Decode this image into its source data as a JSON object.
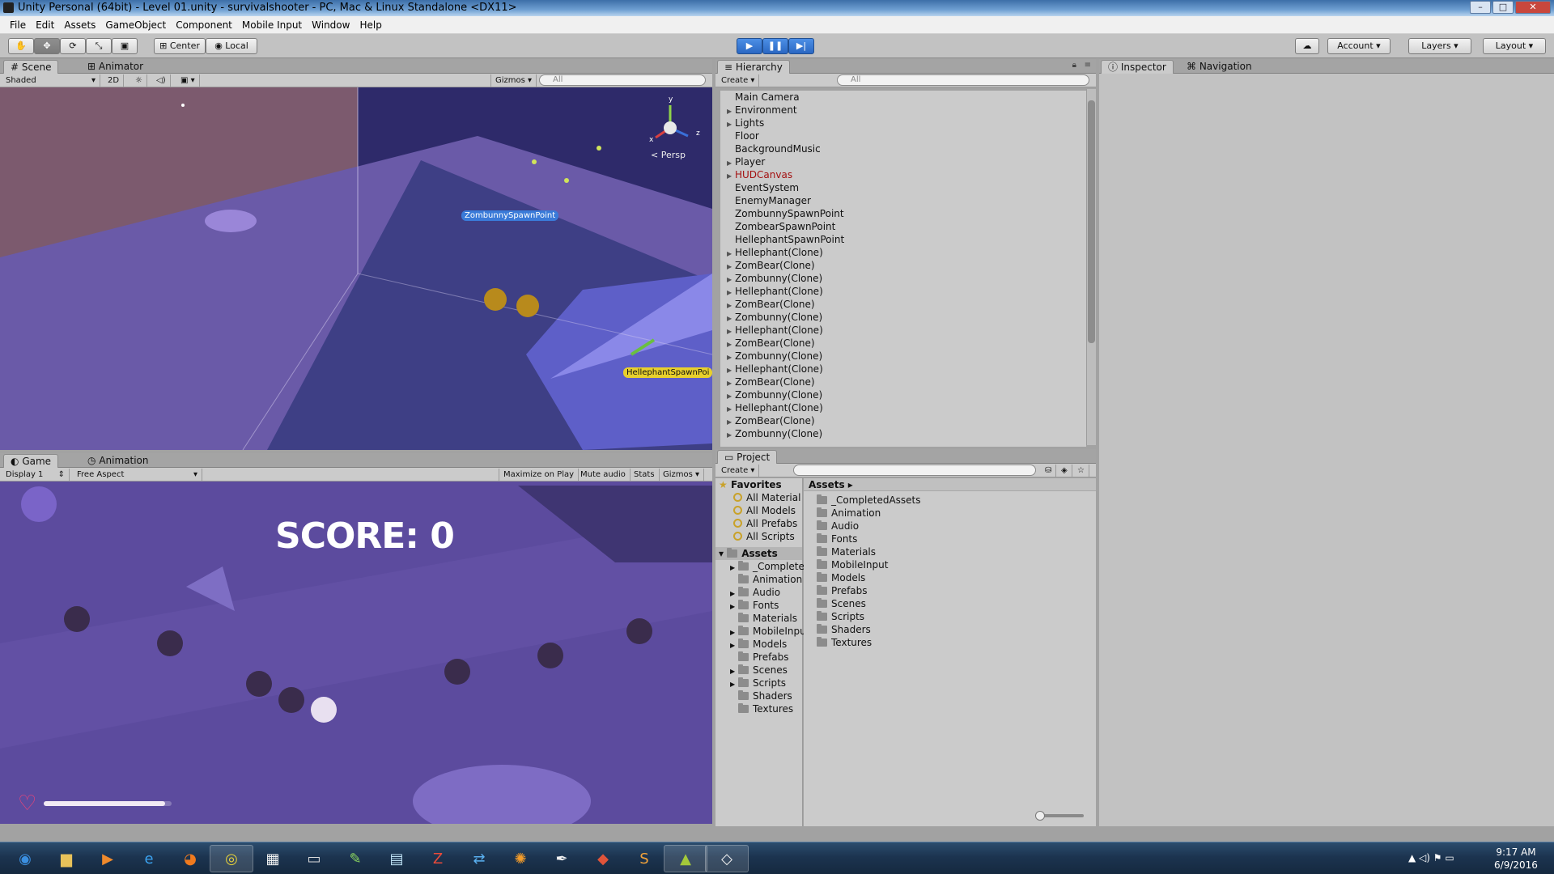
{
  "window": {
    "title": "Unity Personal (64bit) - Level 01.unity - survivalshooter - PC, Mac & Linux Standalone <DX11>"
  },
  "menu": [
    "File",
    "Edit",
    "Assets",
    "GameObject",
    "Component",
    "Mobile Input",
    "Window",
    "Help"
  ],
  "toolbar": {
    "pivot_label": "Center",
    "space_label": "Local",
    "account_label": "Account",
    "layers_label": "Layers",
    "layout_label": "Layout"
  },
  "scene_panel": {
    "tabs": [
      "Scene",
      "Animator"
    ],
    "shading": "Shaded",
    "mode_2d": "2D",
    "gizmos": "Gizmos",
    "search_placeholder": "All",
    "persp_label": "Persp",
    "label_zombunny": "ZombunnySpawnPoint",
    "label_hellephant": "HellephantSpawnPoi",
    "axis_y": "y",
    "axis_x": "x",
    "axis_z": "z"
  },
  "game_panel": {
    "tabs": [
      "Game",
      "Animation"
    ],
    "display": "Display 1",
    "aspect": "Free Aspect",
    "maximize": "Maximize on Play",
    "mute": "Mute audio",
    "stats": "Stats",
    "gizmos": "Gizmos",
    "score_text": "SCORE: 0",
    "health_fraction": 0.95
  },
  "hierarchy": {
    "tab": "Hierarchy",
    "create": "Create",
    "search_placeholder": "All",
    "items": [
      {
        "label": "Main Camera",
        "arrow": false,
        "red": false
      },
      {
        "label": "Environment",
        "arrow": true,
        "red": false
      },
      {
        "label": "Lights",
        "arrow": true,
        "red": false
      },
      {
        "label": "Floor",
        "arrow": false,
        "red": false
      },
      {
        "label": "BackgroundMusic",
        "arrow": false,
        "red": false
      },
      {
        "label": "Player",
        "arrow": true,
        "red": false
      },
      {
        "label": "HUDCanvas",
        "arrow": true,
        "red": true
      },
      {
        "label": "EventSystem",
        "arrow": false,
        "red": false
      },
      {
        "label": "EnemyManager",
        "arrow": false,
        "red": false
      },
      {
        "label": "ZombunnySpawnPoint",
        "arrow": false,
        "red": false
      },
      {
        "label": "ZombearSpawnPoint",
        "arrow": false,
        "red": false
      },
      {
        "label": "HellephantSpawnPoint",
        "arrow": false,
        "red": false
      },
      {
        "label": "Hellephant(Clone)",
        "arrow": true,
        "red": false
      },
      {
        "label": "ZomBear(Clone)",
        "arrow": true,
        "red": false
      },
      {
        "label": "Zombunny(Clone)",
        "arrow": true,
        "red": false
      },
      {
        "label": "Hellephant(Clone)",
        "arrow": true,
        "red": false
      },
      {
        "label": "ZomBear(Clone)",
        "arrow": true,
        "red": false
      },
      {
        "label": "Zombunny(Clone)",
        "arrow": true,
        "red": false
      },
      {
        "label": "Hellephant(Clone)",
        "arrow": true,
        "red": false
      },
      {
        "label": "ZomBear(Clone)",
        "arrow": true,
        "red": false
      },
      {
        "label": "Zombunny(Clone)",
        "arrow": true,
        "red": false
      },
      {
        "label": "Hellephant(Clone)",
        "arrow": true,
        "red": false
      },
      {
        "label": "ZomBear(Clone)",
        "arrow": true,
        "red": false
      },
      {
        "label": "Zombunny(Clone)",
        "arrow": true,
        "red": false
      },
      {
        "label": "Hellephant(Clone)",
        "arrow": true,
        "red": false
      },
      {
        "label": "ZomBear(Clone)",
        "arrow": true,
        "red": false
      },
      {
        "label": "Zombunny(Clone)",
        "arrow": true,
        "red": false
      }
    ]
  },
  "project": {
    "tab": "Project",
    "create": "Create",
    "favorites_label": "Favorites",
    "favorites": [
      "All Material",
      "All Models",
      "All Prefabs",
      "All Scripts"
    ],
    "tree_root": "Assets",
    "tree": [
      {
        "label": "_Complete",
        "arrow": true
      },
      {
        "label": "Animation",
        "arrow": false
      },
      {
        "label": "Audio",
        "arrow": true
      },
      {
        "label": "Fonts",
        "arrow": true
      },
      {
        "label": "Materials",
        "arrow": false
      },
      {
        "label": "MobileInpu",
        "arrow": true
      },
      {
        "label": "Models",
        "arrow": true
      },
      {
        "label": "Prefabs",
        "arrow": false
      },
      {
        "label": "Scenes",
        "arrow": true
      },
      {
        "label": "Scripts",
        "arrow": true
      },
      {
        "label": "Shaders",
        "arrow": false
      },
      {
        "label": "Textures",
        "arrow": false
      }
    ],
    "breadcrumb": "Assets",
    "folders": [
      "_CompletedAssets",
      "Animation",
      "Audio",
      "Fonts",
      "Materials",
      "MobileInput",
      "Models",
      "Prefabs",
      "Scenes",
      "Scripts",
      "Shaders",
      "Textures"
    ]
  },
  "inspector": {
    "tabs": [
      "Inspector",
      "Navigation"
    ]
  },
  "taskbar": {
    "time": "9:17 AM",
    "date": "6/9/2016",
    "apps": [
      {
        "name": "start-orb",
        "glyph": "◉",
        "color": "#3b8fe0",
        "running": false
      },
      {
        "name": "explorer",
        "glyph": "▆",
        "color": "#e8c25a",
        "running": false
      },
      {
        "name": "media-player",
        "glyph": "▶",
        "color": "#f08a2c",
        "running": false
      },
      {
        "name": "internet-explorer",
        "glyph": "e",
        "color": "#3ba3f0",
        "running": false
      },
      {
        "name": "firefox",
        "glyph": "◕",
        "color": "#f07a1e",
        "running": false
      },
      {
        "name": "chrome",
        "glyph": "◎",
        "color": "#e8d23a",
        "running": true
      },
      {
        "name": "apps-grid",
        "glyph": "▦",
        "color": "#f2f2f2",
        "running": false
      },
      {
        "name": "command-prompt",
        "glyph": "▭",
        "color": "#dddddd",
        "running": false
      },
      {
        "name": "notepad-plus",
        "glyph": "✎",
        "color": "#8ed860",
        "running": false
      },
      {
        "name": "notepad",
        "glyph": "▤",
        "color": "#bfe2f5",
        "running": false
      },
      {
        "name": "filezilla",
        "glyph": "Z",
        "color": "#e84a3a",
        "running": false
      },
      {
        "name": "network-tool",
        "glyph": "⇄",
        "color": "#5ab0f0",
        "running": false
      },
      {
        "name": "blender",
        "glyph": "✺",
        "color": "#f39c2a",
        "running": false
      },
      {
        "name": "inkscape",
        "glyph": "✒",
        "color": "#f2f2f2",
        "running": false
      },
      {
        "name": "git",
        "glyph": "◆",
        "color": "#e0543a",
        "running": false
      },
      {
        "name": "sublime",
        "glyph": "S",
        "color": "#f2a23a",
        "running": false
      },
      {
        "name": "android",
        "glyph": "▲",
        "color": "#a4c93a",
        "running": true
      },
      {
        "name": "unity",
        "glyph": "◇",
        "color": "#f2f2f2",
        "running": true
      }
    ]
  }
}
